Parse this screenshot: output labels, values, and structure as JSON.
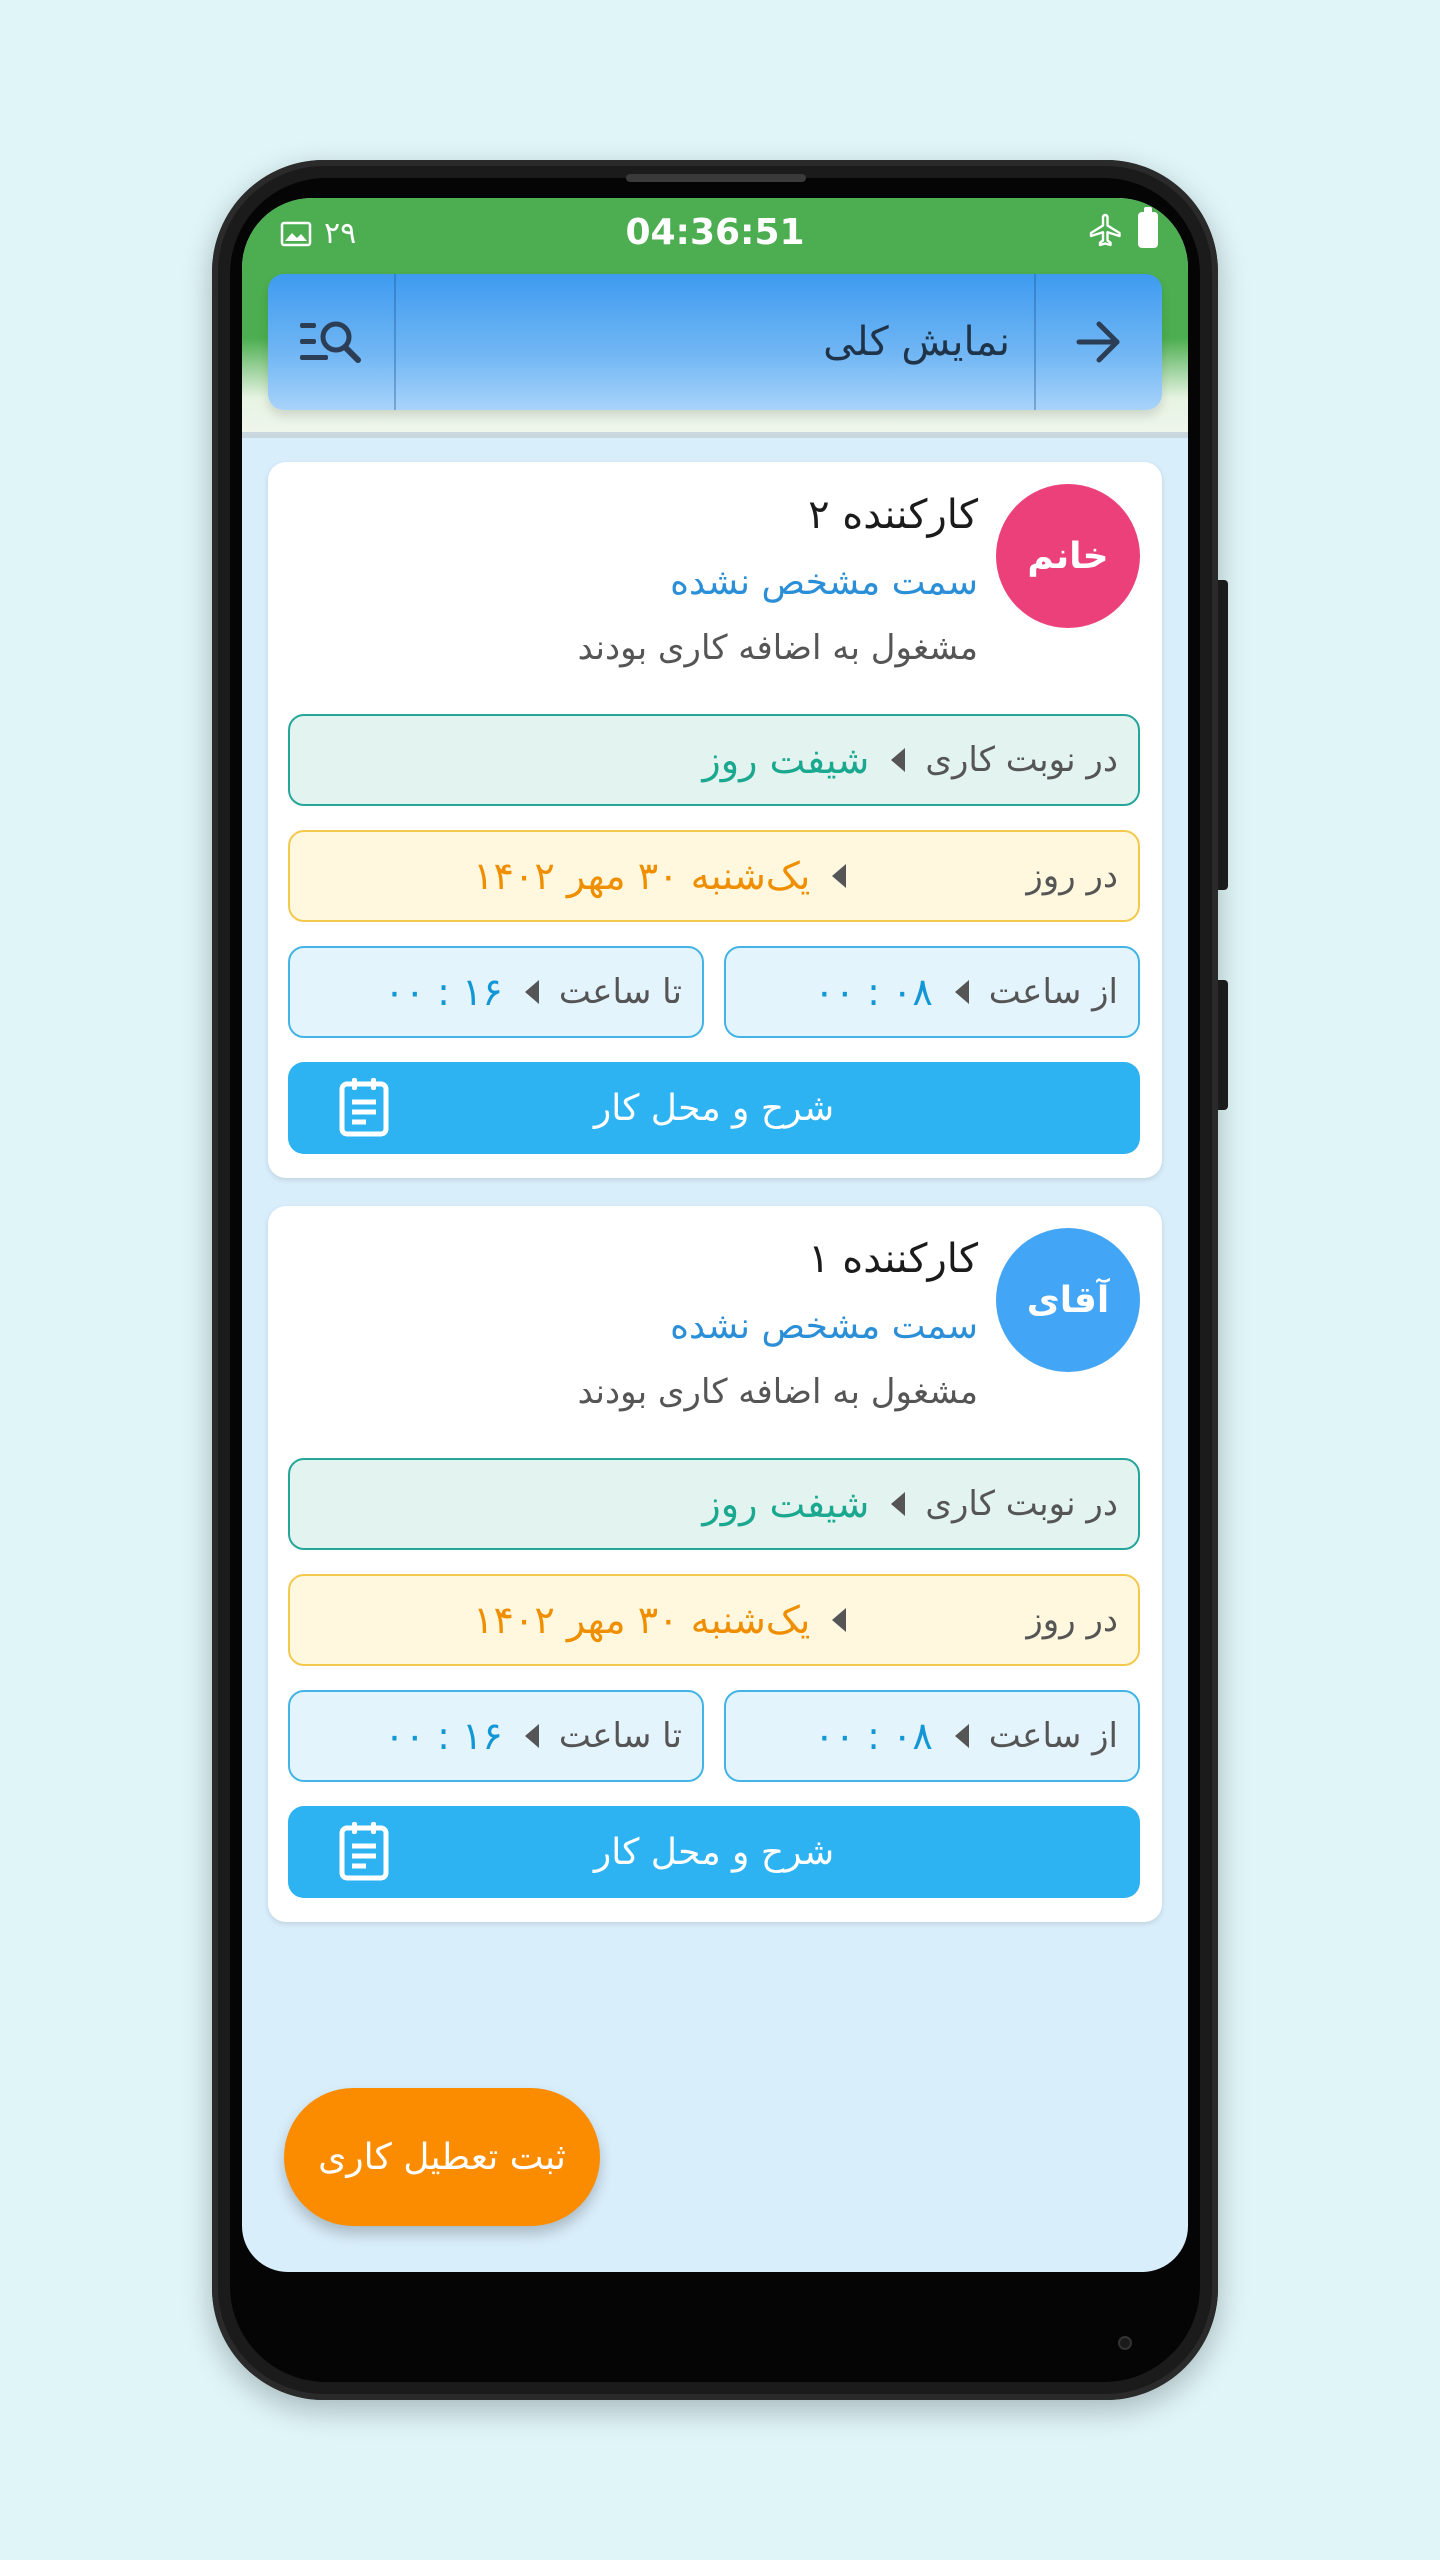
{
  "status_bar": {
    "left_text": "۲۹",
    "time": "04:36:51"
  },
  "app_bar": {
    "title": "نمایش کلی"
  },
  "cards": [
    {
      "avatar_label": "خانم",
      "avatar_color": "#ec407a",
      "name": "کارکننده ۲",
      "role": "سمت مشخص نشده",
      "status": "مشغول به اضافه کاری بودند",
      "shift_label": "در نوبت کاری",
      "shift_value": "شیفت روز",
      "day_label": "در روز",
      "day_value": "یک‌شنبه ۳۰ مهر ۱۴۰۲",
      "from_label": "از ساعت",
      "from_value": "۰۸ : ۰۰",
      "to_label": "تا ساعت",
      "to_value": "۱۶ : ۰۰",
      "button_label": "شرح و محل کار"
    },
    {
      "avatar_label": "آقای",
      "avatar_color": "#42a5f5",
      "name": "کارکننده ۱",
      "role": "سمت مشخص نشده",
      "status": "مشغول به اضافه کاری بودند",
      "shift_label": "در نوبت کاری",
      "shift_value": "شیفت روز",
      "day_label": "در روز",
      "day_value": "یک‌شنبه ۳۰ مهر ۱۴۰۲",
      "from_label": "از ساعت",
      "from_value": "۰۸ : ۰۰",
      "to_label": "تا ساعت",
      "to_value": "۱۶ : ۰۰",
      "button_label": "شرح و محل کار"
    }
  ],
  "fab": {
    "label": "ثبت تعطیل کاری"
  },
  "colors": {
    "status_bar": "#4cae50",
    "app_bar": "#3e9bf0",
    "button": "#2eb3f2",
    "fab": "#fb8c00"
  }
}
